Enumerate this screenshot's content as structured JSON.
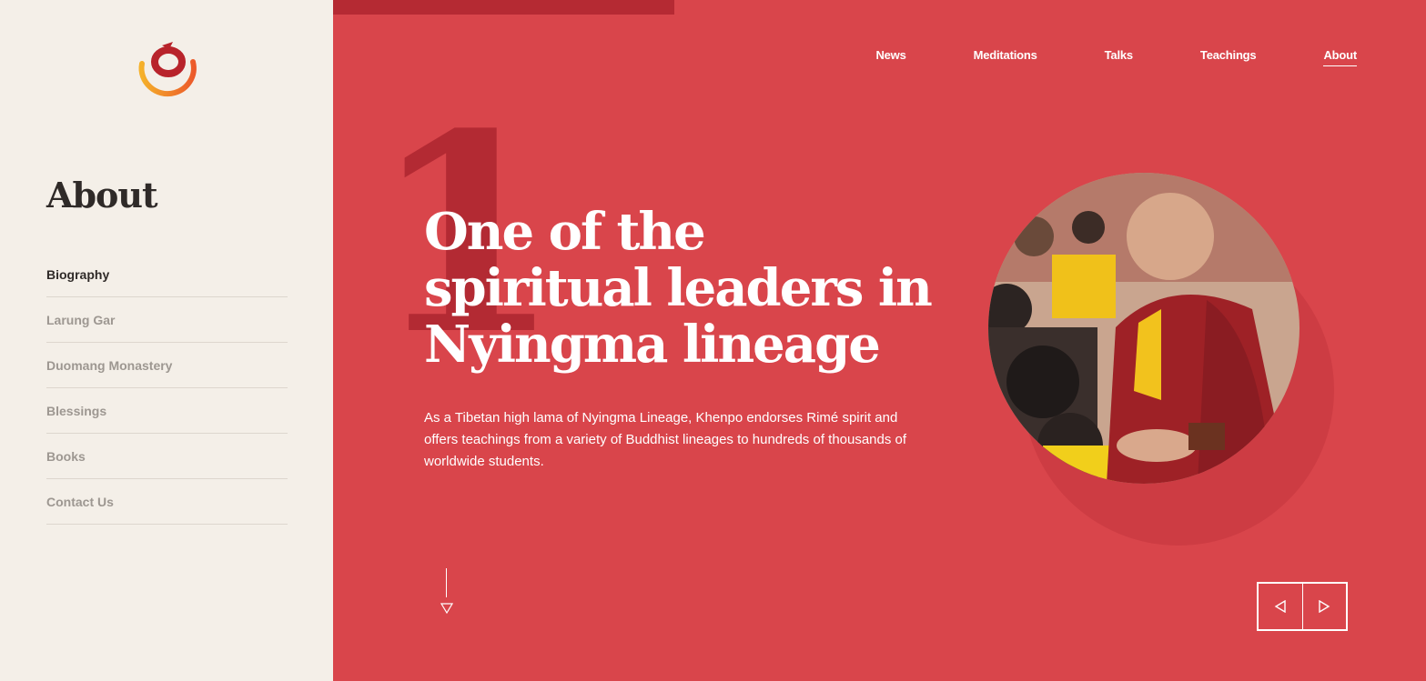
{
  "sidebar": {
    "title": "About",
    "items": [
      {
        "label": "Biography",
        "active": true
      },
      {
        "label": "Larung Gar"
      },
      {
        "label": "Duomang Monastery"
      },
      {
        "label": "Blessings"
      },
      {
        "label": "Books"
      },
      {
        "label": "Contact Us"
      }
    ]
  },
  "nav": {
    "items": [
      {
        "label": "News"
      },
      {
        "label": "Meditations"
      },
      {
        "label": "Talks"
      },
      {
        "label": "Teachings"
      },
      {
        "label": "About",
        "active": true
      }
    ]
  },
  "hero": {
    "number": "1",
    "headline": "One of the spiritual leaders in Nyingma lineage",
    "body": "As a Tibetan high lama of Nyingma Lineage, Khenpo endorses Rimé spirit and offers teachings from a variety of Buddhist lineages to hundreds of thousands of worldwide students."
  },
  "colors": {
    "hero_bg": "#d9454b",
    "sidebar_bg": "#f4efe8",
    "accent_dark": "#b32a33"
  },
  "icons": [
    "logo-icon",
    "scroll-down-icon",
    "prev-arrow-icon",
    "next-arrow-icon"
  ]
}
